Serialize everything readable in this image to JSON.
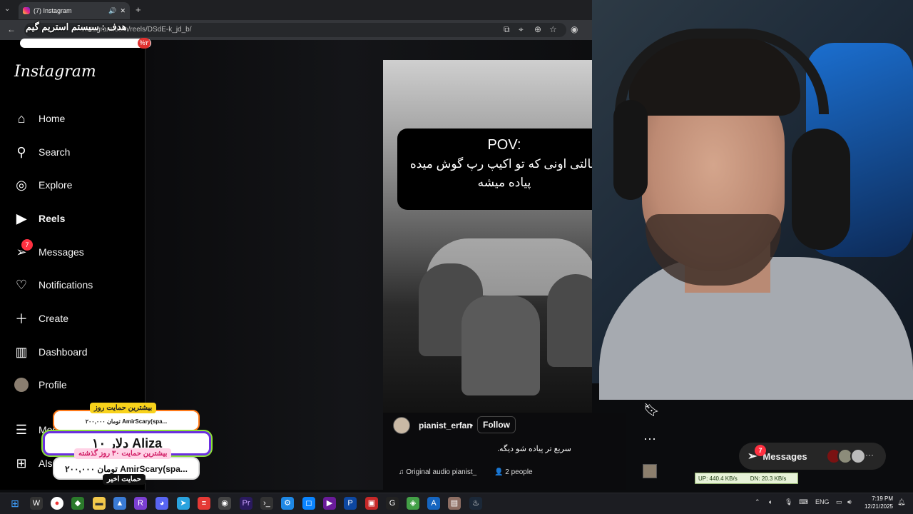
{
  "browser": {
    "tab_title": "(7) Instagram",
    "new_tab": "+",
    "url": "instagram.com/reels/DSdE-k_jd_b/",
    "url_visible_tail": "dE-k_jd_b/"
  },
  "sidebar": {
    "logo": "Instagram",
    "items": [
      {
        "label": "Home",
        "icon": "home-icon"
      },
      {
        "label": "Search",
        "icon": "search-icon"
      },
      {
        "label": "Explore",
        "icon": "compass-icon"
      },
      {
        "label": "Reels",
        "icon": "reels-icon"
      },
      {
        "label": "Messages",
        "icon": "send-icon",
        "badge": "7"
      },
      {
        "label": "Notifications",
        "icon": "heart-icon"
      },
      {
        "label": "Create",
        "icon": "plus-icon"
      },
      {
        "label": "Dashboard",
        "icon": "dashboard-icon"
      },
      {
        "label": "Profile",
        "icon": "avatar"
      },
      {
        "label": "More",
        "icon": "menu-icon"
      },
      {
        "label": "Also from Meta",
        "icon": "grid-icon"
      }
    ]
  },
  "reel": {
    "pov_title": "POV:",
    "pov_text": "حالتی اونی که تو اکیپ رپ گوش میده پیاده میشه",
    "username": "pianist_erfan",
    "dot": "•",
    "follow_label": "Follow",
    "caption": "سریع تر پیاده شو دیگه.",
    "audio": "Original audio  pianist_",
    "people": "2 people"
  },
  "messages_pill": {
    "label": "Messages",
    "badge": "7",
    "more": "···"
  },
  "netspeed": {
    "up": "UP: 440.4 KB/s",
    "down": "DN: 20.3 KB/s"
  },
  "stream_overlay": {
    "goal_text": "هدف : سیستم استریم گیم",
    "goal_percent": "%۲",
    "goal_progress": 0.02,
    "tag_day": "بیشترین حمایت روز",
    "day_line": "۲۰۰,۰۰۰ تومان  AmirScary(spa...",
    "latest_donation": "۱۰ دلار  Aliza",
    "tag_past": "بیشترین حمایت ۳۰ روز گذشته",
    "past_line": "۲۰۰,۰۰۰ تومان  AmirScary(spa...",
    "tag_last": "حمایت اخیر"
  },
  "taskbar": {
    "lang": "ENG",
    "time": "7:19 PM",
    "date": "12/21/2025"
  }
}
